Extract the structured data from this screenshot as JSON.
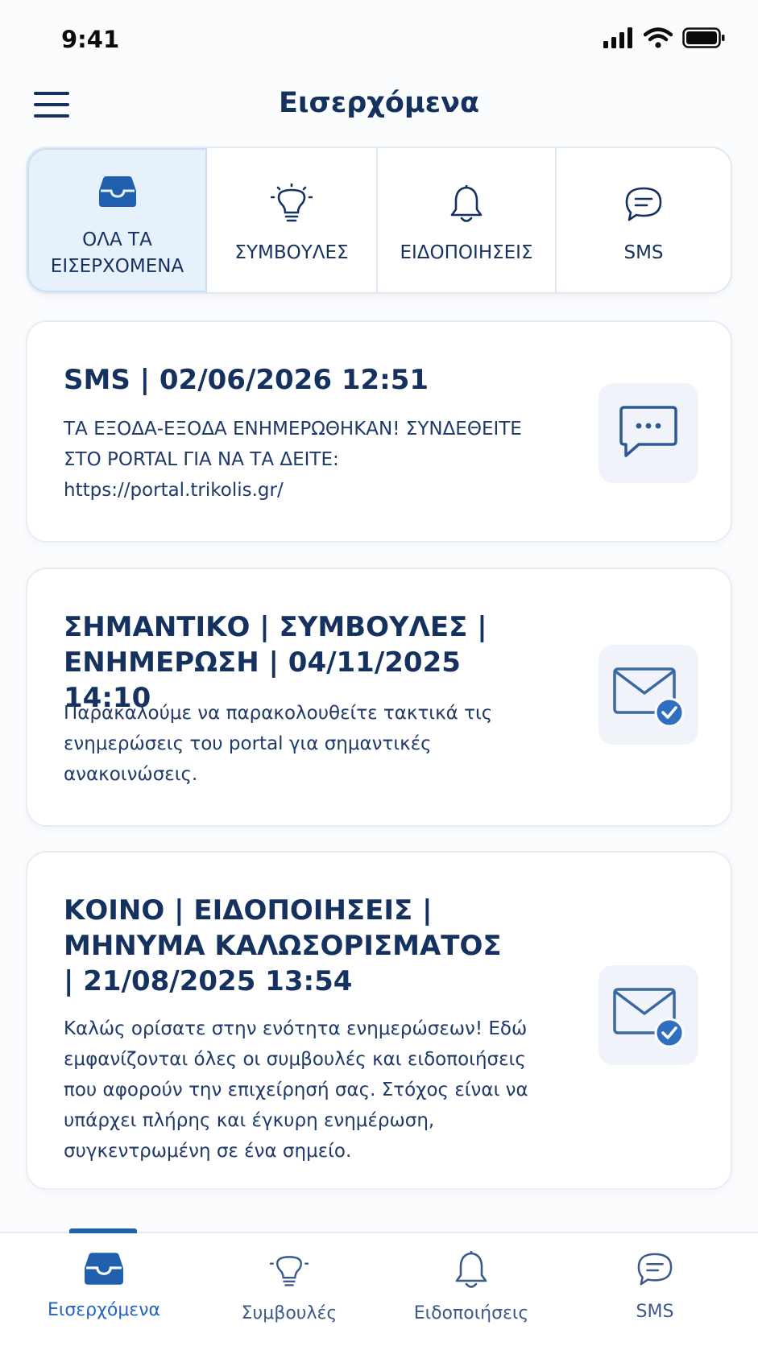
{
  "status_bar": {
    "time": "9:41"
  },
  "header": {
    "title": "Εισερχόμενα"
  },
  "filter_tabs": [
    {
      "label": "ΟΛΑ ΤΑ\nΕΙΣΕΡΧΟΜΕΝΑ",
      "icon": "inbox-icon",
      "active": true
    },
    {
      "label": "ΣΥΜΒΟΥΛΕΣ",
      "icon": "lightbulb-icon",
      "active": false
    },
    {
      "label": "ΕΙΔΟΠΟΙΗΣΕΙΣ",
      "icon": "bell-icon",
      "active": false
    },
    {
      "label": "SMS",
      "icon": "chat-icon",
      "active": false
    }
  ],
  "messages": [
    {
      "title": "SMS | 02/06/2026 12:51",
      "body": "ΤΑ ΕΞΟΔΑ-ΕΞΟΔΑ ΕΝΗΜΕΡΩΘΗΚΑΝ! ΣΥΝΔΕΘΕΙΤΕ ΣΤΟ PORTAL ΓΙΑ ΝΑ ΤΑ ΔΕΙΤΕ: https://portal.trikolis.gr/",
      "icon": "sms-bubble-icon"
    },
    {
      "title": "ΣΗΜΑΝΤΙΚΟ | ΣΥΜΒΟΥΛΕΣ | ΕΝΗΜΕΡΩΣΗ | 04/11/2025 14:10",
      "body": "Παρακαλούμε να παρακολουθείτε τακτικά τις ενημερώσεις του portal για σημαντικές ανακοινώσεις.",
      "icon": "mail-read-icon"
    },
    {
      "title": "ΚΟΙΝΟ | ΕΙΔΟΠΟΙΗΣΕΙΣ | ΜΗΝΥΜΑ ΚΑΛΩΣΟΡΙΣΜΑΤΟΣ | 21/08/2025 13:54",
      "body": "Καλώς ορίσατε στην ενότητα ενημερώσεων! Εδώ εμφανίζονται όλες οι συμβουλές και ειδοποιήσεις που αφορούν την επιχείρησή σας. Στόχος είναι να υπάρχει πλήρης και έγκυρη ενημέρωση, συγκεντρωμένη σε ένα σημείο.",
      "icon": "mail-read-icon"
    }
  ],
  "bottom_nav": [
    {
      "label": "Εισερχόμενα",
      "icon": "inbox-icon",
      "active": true
    },
    {
      "label": "Συμβουλές",
      "icon": "lightbulb-icon",
      "active": false
    },
    {
      "label": "Ειδοποιήσεις",
      "icon": "bell-icon",
      "active": false
    },
    {
      "label": "SMS",
      "icon": "chat-icon",
      "active": false
    }
  ],
  "colors": {
    "primary": "#15315f",
    "accent": "#1f5fae",
    "active_tab_bg": "#e6f1fc",
    "icon_tile_bg": "#f0f4fa",
    "check_badge": "#2f6ec0"
  }
}
